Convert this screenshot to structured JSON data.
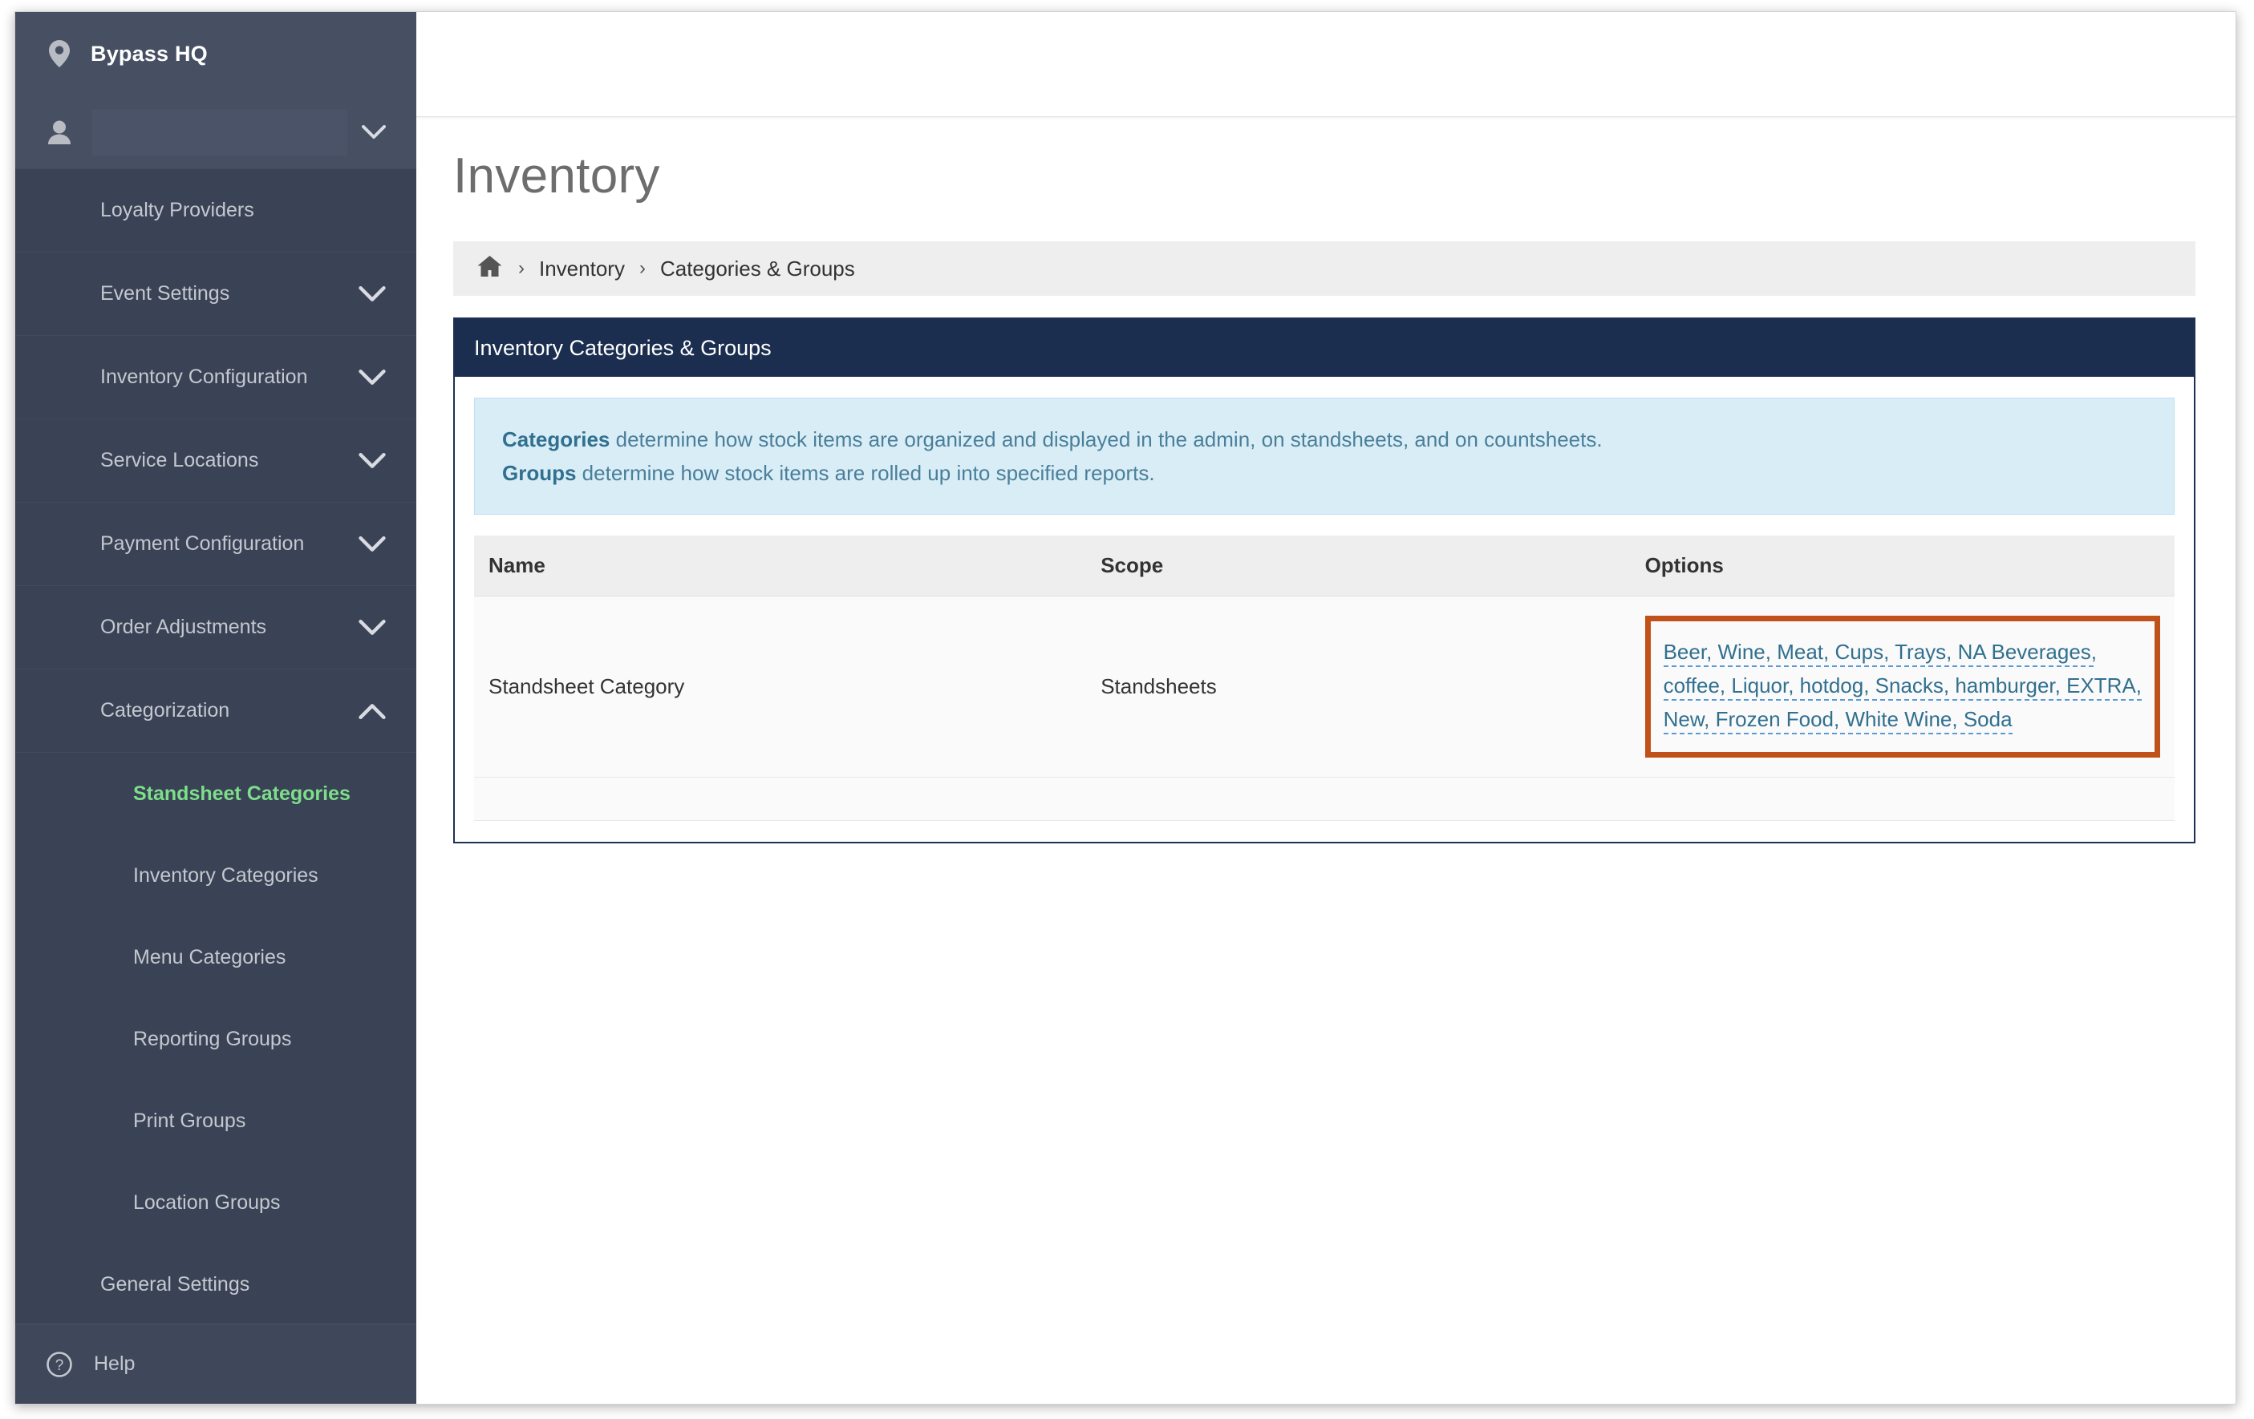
{
  "sidebar": {
    "brand": {
      "label": "Bypass HQ",
      "icon": "map-pin-icon"
    },
    "user": {
      "name": "",
      "icon": "user-icon",
      "chevron": "chevron-down-icon"
    },
    "items": [
      {
        "label": "Loyalty Providers",
        "chevron": ""
      },
      {
        "label": "Event Settings",
        "chevron": "chevron-down-icon"
      },
      {
        "label": "Inventory Configuration",
        "chevron": "chevron-down-icon"
      },
      {
        "label": "Service Locations",
        "chevron": "chevron-down-icon"
      },
      {
        "label": "Payment Configuration",
        "chevron": "chevron-down-icon"
      },
      {
        "label": "Order Adjustments",
        "chevron": "chevron-down-icon"
      },
      {
        "label": "Categorization",
        "chevron": "chevron-up-icon"
      }
    ],
    "sub_items": [
      {
        "label": "Standsheet Categories",
        "active": true
      },
      {
        "label": "Inventory Categories",
        "active": false
      },
      {
        "label": "Menu Categories",
        "active": false
      },
      {
        "label": "Reporting Groups",
        "active": false
      },
      {
        "label": "Print Groups",
        "active": false
      },
      {
        "label": "Location Groups",
        "active": false
      },
      {
        "label": "General Settings",
        "active": false
      }
    ],
    "help": {
      "label": "Help",
      "icon": "question-circle-icon"
    },
    "colors": {
      "background": "#3a4255",
      "header_background": "#474f63",
      "text": "#c4c8cf",
      "active_text": "#7ddf8a"
    }
  },
  "main": {
    "page_title": "Inventory",
    "breadcrumb": {
      "home_icon": "home-icon",
      "separator": "›",
      "items": [
        "Inventory",
        "Categories & Groups"
      ]
    },
    "card": {
      "header": "Inventory Categories & Groups",
      "info": {
        "line1_bold": "Categories",
        "line1_rest": " determine how stock items are organized and displayed in the admin, on standsheets, and on countsheets.",
        "line2_bold": "Groups",
        "line2_rest": " determine how stock items are rolled up into specified reports."
      },
      "table": {
        "columns": [
          "Name",
          "Scope",
          "Options"
        ],
        "rows": [
          {
            "name": "Standsheet Category",
            "scope": "Standsheets",
            "options": "Beer, Wine, Meat, Cups, Trays, NA Beverages, coffee, Liquor, hotdog, Snacks, hamburger, EXTRA, New, Frozen Food, White Wine, Soda",
            "options_list": [
              "Beer",
              "Wine",
              "Meat",
              "Cups",
              "Trays",
              "NA Beverages",
              "coffee",
              "Liquor",
              "hotdog",
              "Snacks",
              "hamburger",
              "EXTRA",
              "New",
              "Frozen Food",
              "White Wine",
              "Soda"
            ],
            "highlighted": true
          }
        ]
      }
    }
  },
  "colors": {
    "card_border": "#1e3054",
    "card_header": "#1b2e4f",
    "info_background": "#d9edf7",
    "info_text": "#31708f",
    "highlight_border": "#c1511a",
    "link": "#31708f",
    "breadcrumb_background": "#eeeeee"
  }
}
